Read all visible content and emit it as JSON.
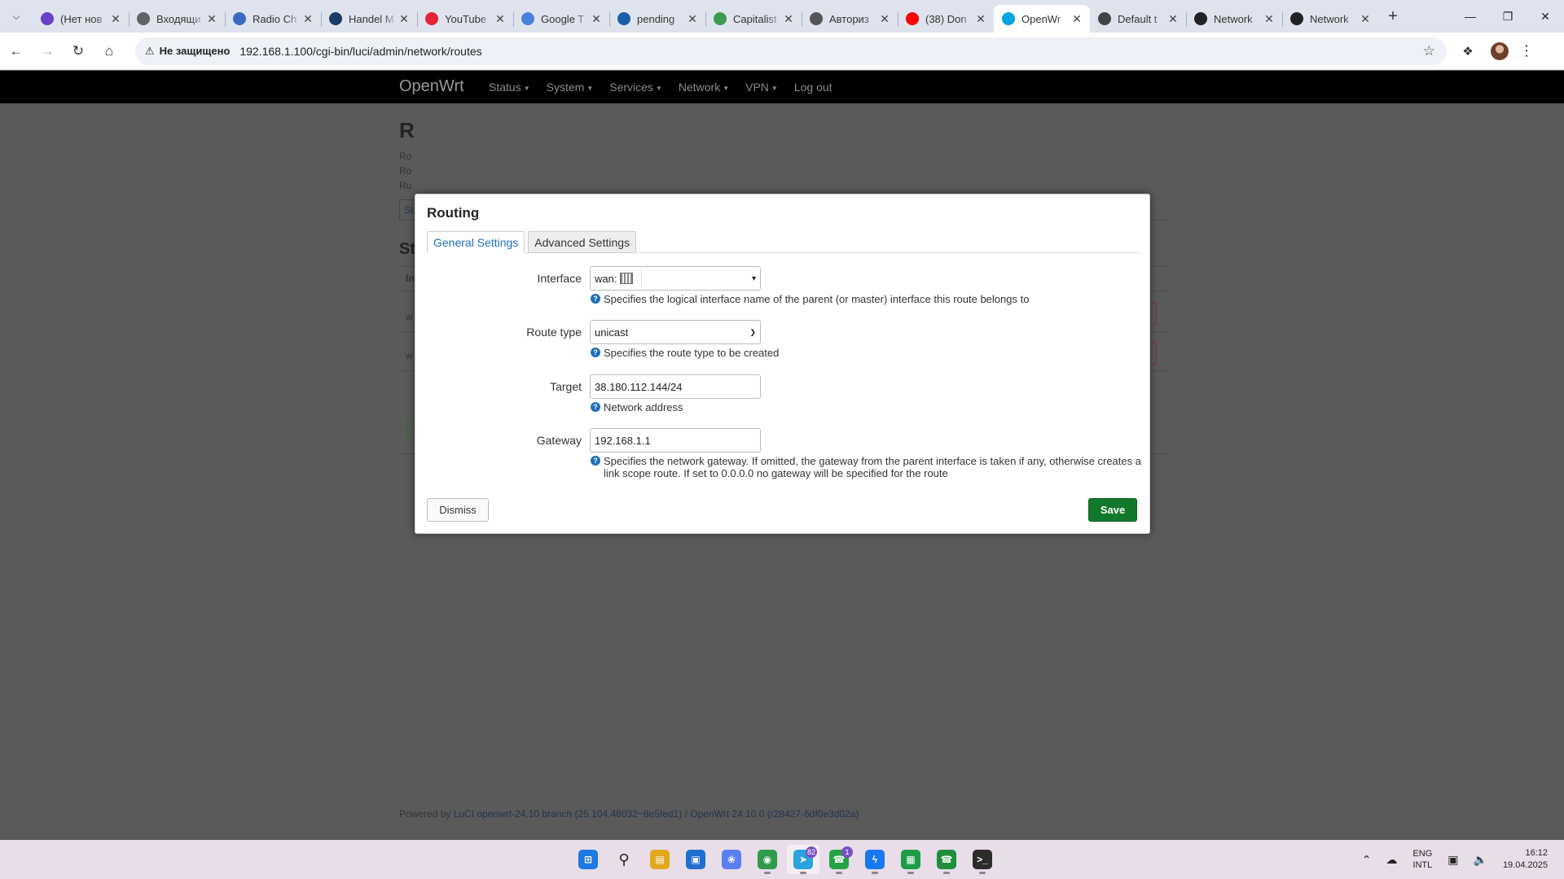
{
  "browser": {
    "tabs": [
      {
        "title": "(Нет нов",
        "icon": "mail-purple-icon",
        "color": "#6c3fc9"
      },
      {
        "title": "Входящи",
        "icon": "inbox-icon",
        "color": "#5f6368"
      },
      {
        "title": "Radio Ch",
        "icon": "radio-globe-icon",
        "color": "#3a6bc4"
      },
      {
        "title": "Handel M",
        "icon": "h-logo-icon",
        "color": "#1b3c66"
      },
      {
        "title": "YouTube",
        "icon": "youtube-music-icon",
        "color": "#e5243b"
      },
      {
        "title": "Google T",
        "icon": "google-translate-icon",
        "color": "#4a7ee0"
      },
      {
        "title": "pending",
        "icon": "hp-logo-icon",
        "color": "#1a5ea8"
      },
      {
        "title": "Capitalist",
        "icon": "cap-logo-icon",
        "color": "#3c9b52"
      },
      {
        "title": "Авториз",
        "icon": "globe-icon",
        "color": "#555555"
      },
      {
        "title": "(38) Don",
        "icon": "youtube-icon",
        "color": "#ff0000"
      },
      {
        "title": "OpenWr",
        "icon": "openwrt-icon",
        "color": "#00a3e0"
      },
      {
        "title": "Default t",
        "icon": "power-icon",
        "color": "#444444"
      },
      {
        "title": "Network",
        "icon": "openwrt-text-icon",
        "color": "#222222"
      },
      {
        "title": "Network",
        "icon": "openwrt-text-icon",
        "color": "#222222"
      }
    ],
    "active_tab": 10,
    "security_label": "Не защищено",
    "url": "192.168.1.100/cgi-bin/luci/admin/network/routes"
  },
  "openwrt": {
    "brand": "OpenWrt",
    "nav": [
      "Status",
      "System",
      "Services",
      "Network",
      "VPN",
      "Log out"
    ],
    "background": {
      "title_partial": "R",
      "lines_partial": [
        "Ro",
        "Ro",
        "Ru"
      ],
      "tab_partial": "St",
      "section_partial": "St",
      "header_partial": "In",
      "row1_partial": "w",
      "row2_partial": "w"
    },
    "footer": {
      "prefix": "Powered by ",
      "luci_link": "LuCI openwrt-24.10 branch (25.104.48032~8e5fed1)",
      "separator": " / ",
      "openwrt_link": "OpenWrt 24.10.0 (r28427-6df0e3d02a)"
    }
  },
  "modal": {
    "title": "Routing",
    "tabs": [
      "General Settings",
      "Advanced Settings"
    ],
    "active_tab": 0,
    "fields": {
      "interface": {
        "label": "Interface",
        "value": "wan:",
        "help": "Specifies the logical interface name of the parent (or master) interface this route belongs to"
      },
      "route_type": {
        "label": "Route type",
        "value": "unicast",
        "help": "Specifies the route type to be created"
      },
      "target": {
        "label": "Target",
        "value": "38.180.112.144/24",
        "help": "Network address"
      },
      "gateway": {
        "label": "Gateway",
        "value": "192.168.1.1",
        "help": "Specifies the network gateway. If omitted, the gateway from the parent interface is taken if any, otherwise creates a link scope route. If set to 0.0.0.0 no gateway will be specified for the route"
      }
    },
    "dismiss_label": "Dismiss",
    "save_label": "Save"
  },
  "taskbar": {
    "apps": [
      {
        "name": "windows-start-icon",
        "color": "#1c7ae0",
        "badge": ""
      },
      {
        "name": "search-icon",
        "color": "#222222",
        "badge": ""
      },
      {
        "name": "file-explorer-icon",
        "color": "#e3a81b",
        "badge": ""
      },
      {
        "name": "store-icon",
        "color": "#1f6fd0",
        "badge": ""
      },
      {
        "name": "copilot-icon",
        "color": "#5a7ff0",
        "badge": ""
      },
      {
        "name": "chrome-icon",
        "color": "#2f9a4a",
        "badge": ""
      },
      {
        "name": "telegram-icon",
        "color": "#2aa3de",
        "badge": "82"
      },
      {
        "name": "whatsapp-business-icon",
        "color": "#25a244",
        "badge": "1"
      },
      {
        "name": "messenger-icon",
        "color": "#1877f2",
        "badge": ""
      },
      {
        "name": "sheets-icon",
        "color": "#1f9b48",
        "badge": ""
      },
      {
        "name": "whatsapp-icon",
        "color": "#1f8f3e",
        "badge": ""
      },
      {
        "name": "terminal-icon",
        "color": "#2b2b2b",
        "badge": ""
      }
    ],
    "lang_top": "ENG",
    "lang_bottom": "INTL",
    "time": "16:12",
    "date": "19.04.2025"
  }
}
